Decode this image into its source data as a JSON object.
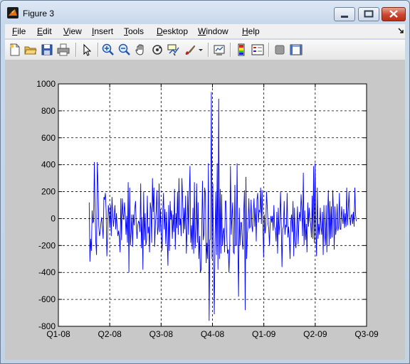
{
  "window": {
    "title": "Figure 3"
  },
  "menu": [
    {
      "label": "File",
      "key": "F",
      "rest": "ile"
    },
    {
      "label": "Edit",
      "key": "E",
      "rest": "dit"
    },
    {
      "label": "View",
      "key": "V",
      "rest": "iew"
    },
    {
      "label": "Insert",
      "key": "I",
      "rest": "nsert"
    },
    {
      "label": "Tools",
      "key": "T",
      "rest": "ools"
    },
    {
      "label": "Desktop",
      "key": "D",
      "rest": "esktop"
    },
    {
      "label": "Window",
      "key": "W",
      "rest": "indow"
    },
    {
      "label": "Help",
      "key": "H",
      "rest": "elp"
    }
  ],
  "toolbar": [
    {
      "icon": "new-figure-icon"
    },
    {
      "icon": "open-file-icon"
    },
    {
      "icon": "save-icon"
    },
    {
      "icon": "print-icon"
    },
    {
      "icon": "edit-plot-arrow-icon"
    },
    {
      "icon": "zoom-in-icon"
    },
    {
      "icon": "zoom-out-icon"
    },
    {
      "icon": "pan-hand-icon"
    },
    {
      "icon": "rotate-3d-icon"
    },
    {
      "icon": "data-cursor-icon"
    },
    {
      "icon": "brush-icon"
    },
    {
      "icon": "link-plot-icon"
    },
    {
      "icon": "colorbar-icon"
    },
    {
      "icon": "legend-icon"
    },
    {
      "icon": "hide-plot-tools-icon"
    },
    {
      "icon": "show-plot-tools-icon"
    }
  ],
  "colors": {
    "line": "#0000ff",
    "figure_bg": "#c8c8c8",
    "axes_bg": "#ffffff"
  },
  "chart_data": {
    "type": "line",
    "title": "",
    "xlabel": "",
    "ylabel": "",
    "grid": true,
    "grid_style": "dashed",
    "ylim": [
      -800,
      1000
    ],
    "yticks": [
      -800,
      -600,
      -400,
      -200,
      0,
      200,
      400,
      600,
      800,
      1000
    ],
    "xlim": [
      0,
      6
    ],
    "xticks": [
      0,
      1,
      2,
      3,
      4,
      5,
      6
    ],
    "xtick_labels": [
      "Q1-08",
      "Q2-08",
      "Q3-08",
      "Q4-08",
      "Q1-09",
      "Q2-09",
      "Q3-09"
    ],
    "series": [
      {
        "color": "#0000ff",
        "x_start": 0.6,
        "x_end": 5.8,
        "values": [
          120,
          -320,
          -150,
          -240,
          60,
          -30,
          -20,
          420,
          80,
          -180,
          -270,
          420,
          260,
          -50,
          -130,
          -100,
          -30,
          10,
          -60,
          -150,
          160,
          140,
          190,
          60,
          -280,
          -120,
          100,
          40,
          -70,
          100,
          -130,
          160,
          30,
          -60,
          20,
          100,
          -80,
          40,
          -60,
          -130,
          -90,
          -140,
          -250,
          150,
          -160,
          150,
          40,
          -10,
          120,
          40,
          -120,
          20,
          -180,
          270,
          -400,
          230,
          -200,
          -100,
          30,
          -210,
          30,
          -50,
          80,
          130,
          -60,
          -150,
          -50,
          -20,
          -30,
          -100,
          260,
          -220,
          10,
          -380,
          200,
          -160,
          40,
          -200,
          -160,
          170,
          -110,
          -60,
          -250,
          120,
          70,
          -180,
          300,
          50,
          230,
          -210,
          -40,
          50,
          210,
          -120,
          -60,
          260,
          -100,
          70,
          -100,
          -240,
          50,
          190,
          -80,
          70,
          -190,
          50,
          -150,
          -350,
          100,
          -240,
          130,
          -10,
          60,
          -150,
          30,
          -100,
          220,
          -230,
          40,
          -70,
          200,
          -120,
          300,
          -50,
          0,
          -130,
          300,
          140,
          -110,
          80,
          -80,
          170,
          -260,
          -80,
          200,
          -120,
          170,
          390,
          -180,
          -50,
          -230,
          80,
          -260,
          270,
          -220,
          -80,
          260,
          -180,
          120,
          -300,
          -130,
          -400,
          -380,
          -60,
          280,
          -160,
          -110,
          230,
          180,
          -330,
          -180,
          -300,
          410,
          -760,
          -160,
          -150,
          940,
          -300,
          260,
          -290,
          -710,
          -180,
          200,
          -270,
          410,
          -380,
          890,
          -300,
          220,
          -260,
          180,
          -200,
          -100,
          -70,
          -250,
          130,
          130,
          -130,
          -260,
          -230,
          -400,
          -200,
          390,
          -120,
          10,
          120,
          -250,
          -260,
          250,
          -200,
          -200,
          410,
          -160,
          -580,
          80,
          -200,
          -30,
          -30,
          -170,
          -230,
          50,
          210,
          -680,
          310,
          -300,
          -110,
          -50,
          150,
          -70,
          -60,
          140,
          -50,
          -100,
          50,
          150,
          -60,
          80,
          -170,
          140,
          190,
          -30,
          60,
          50,
          230,
          -40,
          210,
          -10,
          -290,
          30,
          -110,
          -60,
          200,
          90,
          -40,
          -70,
          -200,
          -30,
          20,
          -30,
          20,
          -90,
          100,
          -60,
          -80,
          -170,
          50,
          -260,
          80,
          -120,
          -30,
          200,
          -50,
          -360,
          -80,
          -60,
          130,
          -120,
          -50,
          -60,
          190,
          -140,
          -60,
          -150,
          -300,
          -20,
          30,
          -100,
          130,
          -280,
          80,
          -170,
          -220,
          -70,
          90,
          -190,
          -20,
          50,
          -20,
          180,
          60,
          -130,
          340,
          -200,
          60,
          -160,
          -40,
          -250,
          120,
          -60,
          80,
          -10,
          -40,
          -140,
          170,
          -150,
          390,
          -180,
          410,
          -100,
          -280,
          230,
          -150,
          -40,
          -120,
          80,
          -60,
          -120,
          50,
          -270,
          100,
          -110,
          -200,
          100,
          -250,
          20,
          210,
          -200,
          130,
          -150,
          90,
          -140,
          210,
          50,
          -230,
          90,
          -120,
          -60,
          110,
          -90,
          -60,
          190,
          -80,
          -80,
          90,
          10,
          -40,
          70,
          -70,
          40,
          -60,
          230,
          -50,
          60,
          200,
          20,
          -50,
          20,
          30,
          -40,
          50,
          -60,
          230,
          30,
          -20
        ]
      }
    ]
  }
}
